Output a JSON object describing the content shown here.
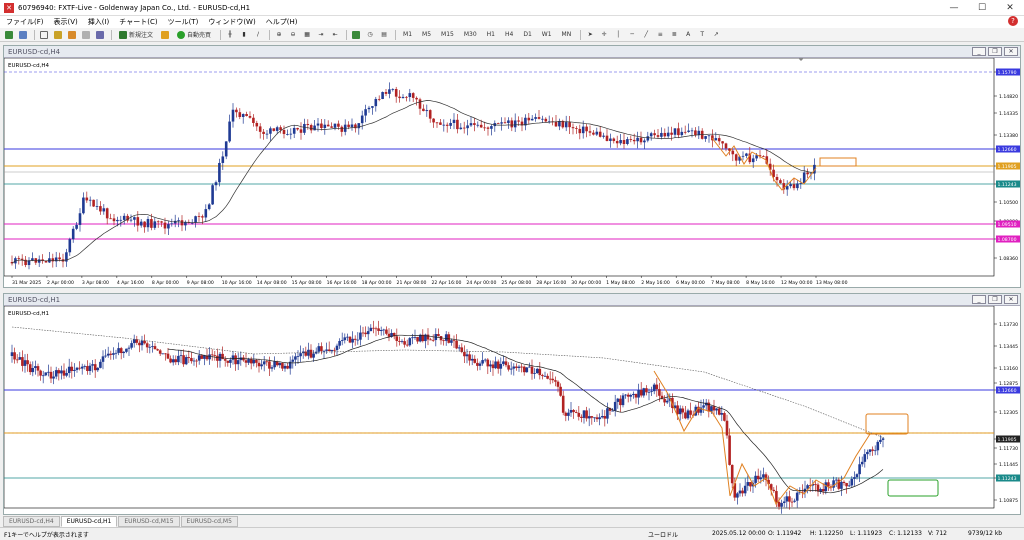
{
  "app": {
    "title": "60796940: FXTF-Live - Goldenway Japan Co., Ltd. - EURUSD-cd,H1"
  },
  "menu": [
    "ファイル(F)",
    "表示(V)",
    "挿入(I)",
    "チャート(C)",
    "ツール(T)",
    "ウィンドウ(W)",
    "ヘルプ(H)"
  ],
  "toolbar": {
    "new_order": "新規注文",
    "auto_trade": "自動売買",
    "timeframes": [
      "M1",
      "M5",
      "M15",
      "M30",
      "H1",
      "H4",
      "D1",
      "W1",
      "MN"
    ]
  },
  "colors": {
    "bull": "#1f3a93",
    "bear": "#b22222",
    "accent": "#e08020"
  },
  "h4": {
    "window_title": "EURUSD-cd,H4",
    "label": "EURUSD-cd,H4",
    "prices": [
      "1.15790",
      "1.14820",
      "1.14335",
      "1.13380",
      "1.12660",
      "1.11905",
      "1.11243",
      "1.10500",
      "1.09980",
      "1.09510",
      "1.08700",
      "1.08360"
    ],
    "dates": [
      "31 Mar 2025",
      "2 Apr 00:00",
      "3 Apr 08:00",
      "4 Apr 16:00",
      "8 Apr 00:00",
      "9 Apr 08:00",
      "10 Apr 16:00",
      "14 Apr 08:00",
      "15 Apr 08:00",
      "16 Apr 16:00",
      "18 Apr 00:00",
      "21 Apr 08:00",
      "22 Apr 16:00",
      "24 Apr 00:00",
      "25 Apr 08:00",
      "28 Apr 16:00",
      "30 Apr 00:00",
      "1 May 08:00",
      "2 May 16:00",
      "6 May 00:00",
      "7 May 08:00",
      "8 May 16:00",
      "12 May 00:00",
      "13 May 08:00"
    ]
  },
  "h1": {
    "window_title": "EURUSD-cd,H1",
    "label": "EURUSD-cd,H1",
    "prices": [
      "1.13730",
      "1.13445",
      "1.13160",
      "1.12875",
      "1.12660",
      "1.12305",
      "1.11905",
      "1.11730",
      "1.11445",
      "1.11243",
      "1.10875"
    ]
  },
  "tabs": [
    "EURUSD-cd,H4",
    "EURUSD-cd,H1",
    "EURUSD-cd,M15",
    "EURUSD-cd,M5"
  ],
  "status": {
    "help": "F1キーでヘルプが表示されます",
    "profile": "ユーロドル",
    "time": "2025.05.12 00:00",
    "open": "O: 1.11942",
    "high": "H: 1.12250",
    "low": "L: 1.11923",
    "close": "C: 1.12133",
    "volume": "V: 712",
    "traffic": "9739/12 kb"
  }
}
